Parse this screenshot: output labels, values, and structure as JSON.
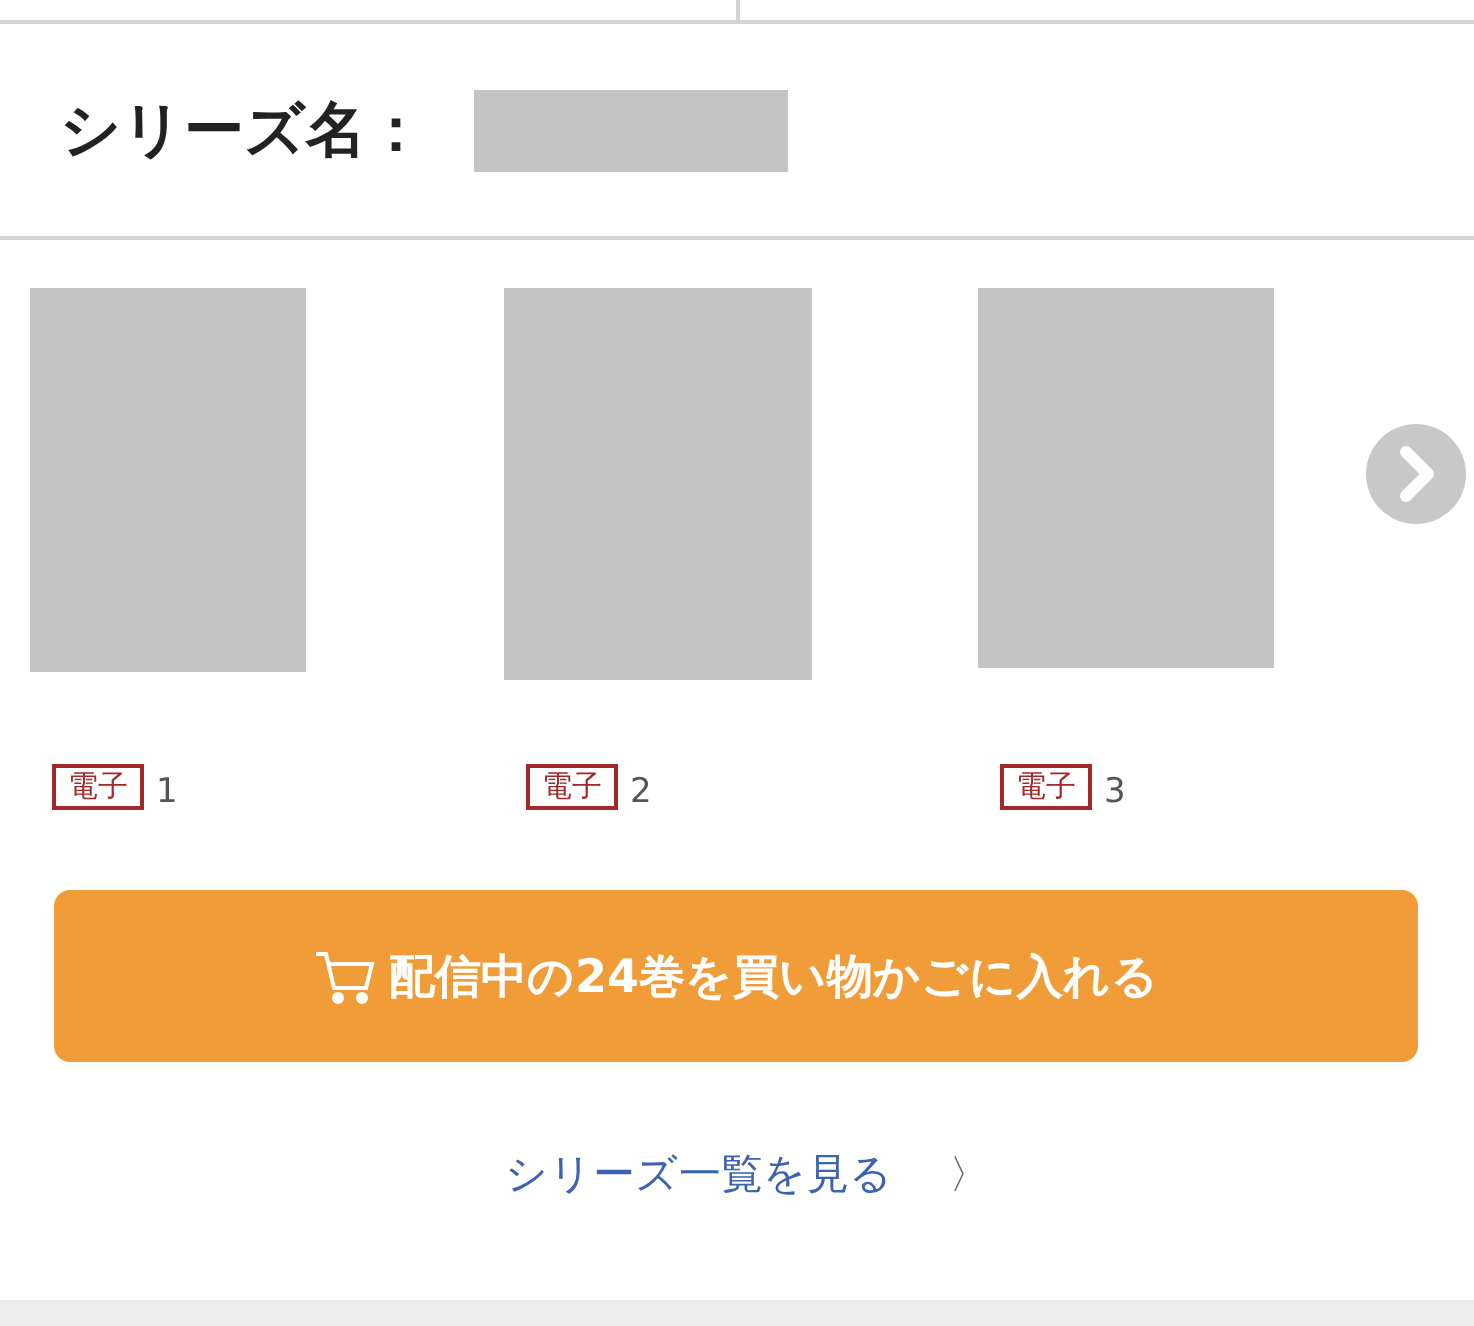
{
  "series": {
    "label": "シリーズ名："
  },
  "volumes": [
    {
      "tag": "電子",
      "number": "1"
    },
    {
      "tag": "電子",
      "number": "2"
    },
    {
      "tag": "電子",
      "number": "3"
    }
  ],
  "cart_button": {
    "label": "配信中の24巻を買い物かごに入れる"
  },
  "series_link": {
    "label": "シリーズ一覧を見る",
    "arrow": "〉"
  }
}
